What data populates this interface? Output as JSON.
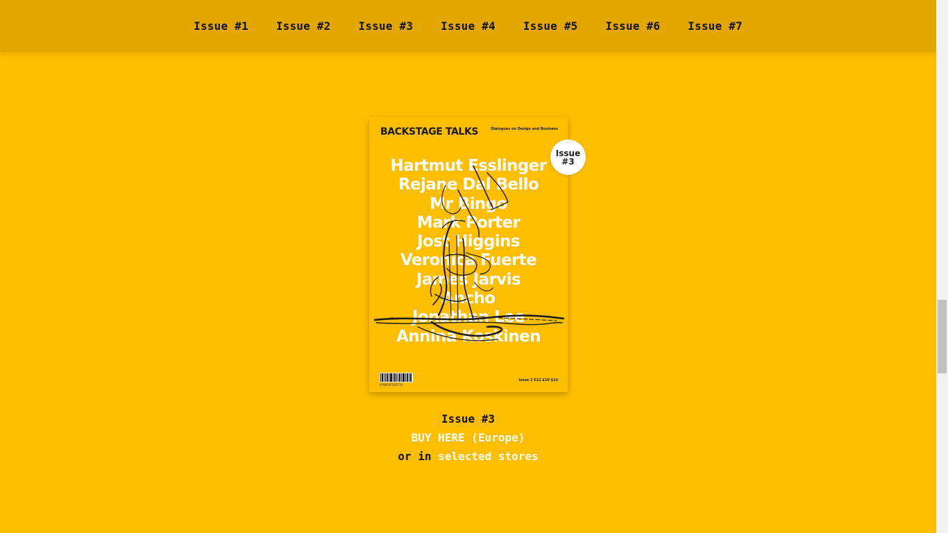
{
  "nav": {
    "items": [
      "Issue #1",
      "Issue #2",
      "Issue #3",
      "Issue #4",
      "Issue #5",
      "Issue #6",
      "Issue #7"
    ]
  },
  "cover": {
    "brand": "BACKSTAGE TALKS",
    "tagline": "Dialogues on Design and Business",
    "names": [
      "Hartmut Esslinger",
      "Rejane Dal Bello",
      "Mr Bingo",
      "Mark Porter",
      "Jost Higgins",
      "Veronica Fuerte",
      "James Jarvis",
      "Ancho",
      "Jonathan Lee",
      "Annina Koskinen"
    ],
    "barcode_number": "9789597243774",
    "price": "Issue 3   €12  £10  $14",
    "badge": {
      "line1": "Issue",
      "line2": "#3"
    }
  },
  "info": {
    "title": "Issue #3",
    "buy_label": "BUY HERE (Europe)",
    "or_in": "or in",
    "stores_label": "selected stores"
  },
  "colors": {
    "background": "#FFBE00",
    "nav_background": "#E2A700",
    "link": "#FFFFFF",
    "text": "#111111"
  }
}
